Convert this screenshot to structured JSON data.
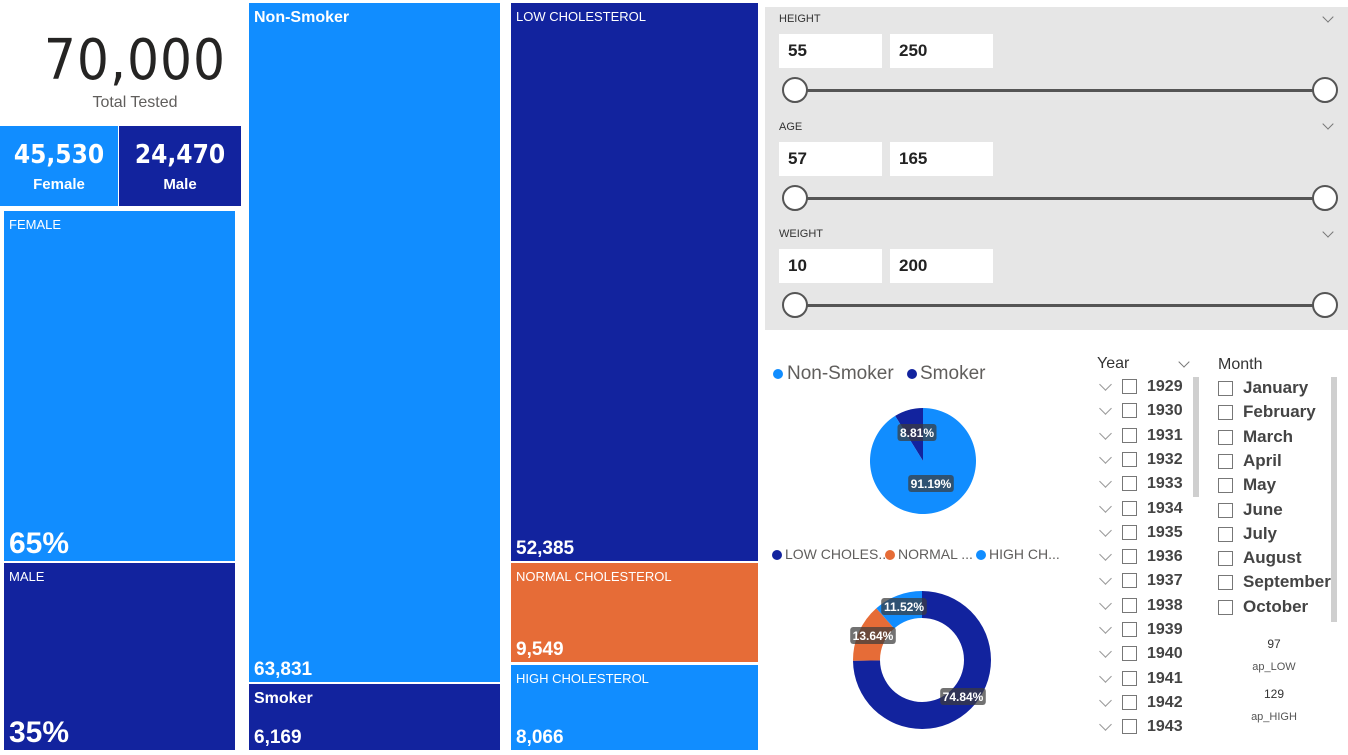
{
  "kpi": {
    "total_value": "70,000",
    "total_label": "Total Tested"
  },
  "gender_cards": [
    {
      "value": "45,530",
      "label": "Female",
      "color": "#118dff"
    },
    {
      "value": "24,470",
      "label": "Male",
      "color": "#12239e"
    }
  ],
  "gender_treemap": [
    {
      "label": "FEMALE",
      "value": "65%",
      "color": "#118dff"
    },
    {
      "label": "MALE",
      "value": "35%",
      "color": "#12239e"
    }
  ],
  "smoker_treemap": [
    {
      "label": "Non-Smoker",
      "value": "63,831",
      "color": "#118dff"
    },
    {
      "label": "Smoker",
      "value": "6,169",
      "color": "#12239e"
    }
  ],
  "cholesterol_treemap": [
    {
      "label": "LOW CHOLESTEROL",
      "value": "52,385",
      "color": "#12239e"
    },
    {
      "label": "NORMAL CHOLESTEROL",
      "value": "9,549",
      "color": "#e66c37"
    },
    {
      "label": "HIGH CHOLESTEROL",
      "value": "8,066",
      "color": "#118dff"
    }
  ],
  "sliders": [
    {
      "label": "HEIGHT",
      "min": "55",
      "max": "250"
    },
    {
      "label": "AGE",
      "min": "57",
      "max": "165"
    },
    {
      "label": "WEIGHT",
      "min": "10",
      "max": "200"
    }
  ],
  "smoker_pie": {
    "legend": [
      {
        "name": "Non-Smoker",
        "color": "#118dff"
      },
      {
        "name": "Smoker",
        "color": "#12239e"
      }
    ],
    "slices": [
      {
        "value": 91.19,
        "label": "91.19%",
        "color": "#118dff"
      },
      {
        "value": 8.81,
        "label": "8.81%",
        "color": "#12239e"
      }
    ]
  },
  "cholesterol_donut": {
    "legend": [
      {
        "name": "LOW CHOLES...",
        "color": "#12239e"
      },
      {
        "name": "NORMAL ...",
        "color": "#e66c37"
      },
      {
        "name": "HIGH CH...",
        "color": "#118dff"
      }
    ],
    "slices": [
      {
        "value": 74.84,
        "label": "74.84%",
        "color": "#12239e"
      },
      {
        "value": 13.64,
        "label": "13.64%",
        "color": "#e66c37"
      },
      {
        "value": 11.52,
        "label": "11.52%",
        "color": "#118dff"
      }
    ]
  },
  "year_filter": {
    "header": "Year",
    "years": [
      "1929",
      "1930",
      "1931",
      "1932",
      "1933",
      "1934",
      "1935",
      "1936",
      "1937",
      "1938",
      "1939",
      "1940",
      "1941",
      "1942",
      "1943"
    ]
  },
  "month_filter": {
    "header": "Month",
    "months": [
      "January",
      "February",
      "March",
      "April",
      "May",
      "June",
      "July",
      "August",
      "September",
      "October"
    ]
  },
  "ap_low": {
    "value": "97",
    "label": "ap_LOW"
  },
  "ap_high": {
    "value": "129",
    "label": "ap_HIGH"
  }
}
